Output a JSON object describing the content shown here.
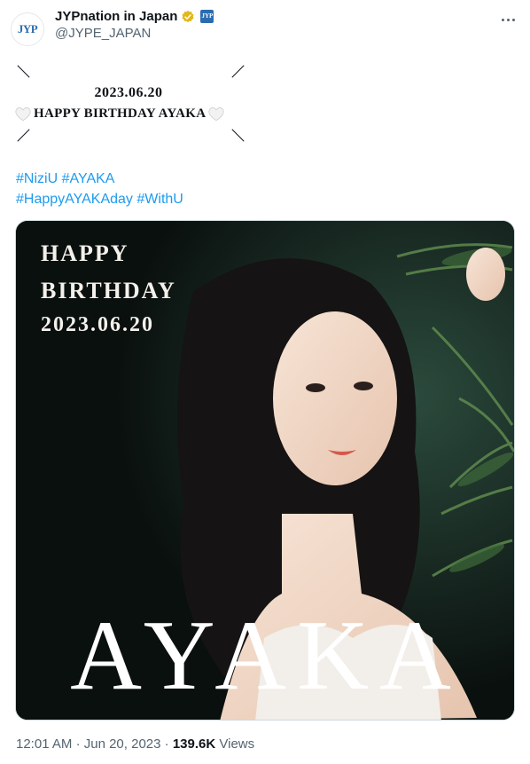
{
  "account": {
    "display_name": "JYPnation in Japan",
    "handle": "@JYPE_JAPAN",
    "avatar_text": "JYP"
  },
  "tweet": {
    "date_line": "2023.06.20",
    "birthday_line": "HAPPY BIRTHDAY AYAKA",
    "hashtags_line1": [
      "#NiziU",
      "#AYAKA"
    ],
    "hashtags_line2": [
      "#HappyAYAKAday",
      "#WithU"
    ]
  },
  "image_overlay": {
    "happy": "HAPPY",
    "birthday": "BIRTHDAY",
    "date": "2023.06.20",
    "name": "AYAKA"
  },
  "meta": {
    "time": "12:01 AM",
    "sep1": "·",
    "date": "Jun 20, 2023",
    "sep2": "·",
    "views_count": "139.6K",
    "views_label": "Views"
  },
  "colors": {
    "link": "#1d9bf0",
    "verified_badge": "#e2b719",
    "affiliate_badge": "#2b6cb0"
  },
  "icons": [
    "verified-badge-icon",
    "affiliate-badge-icon",
    "more-icon",
    "white-heart-icon"
  ]
}
